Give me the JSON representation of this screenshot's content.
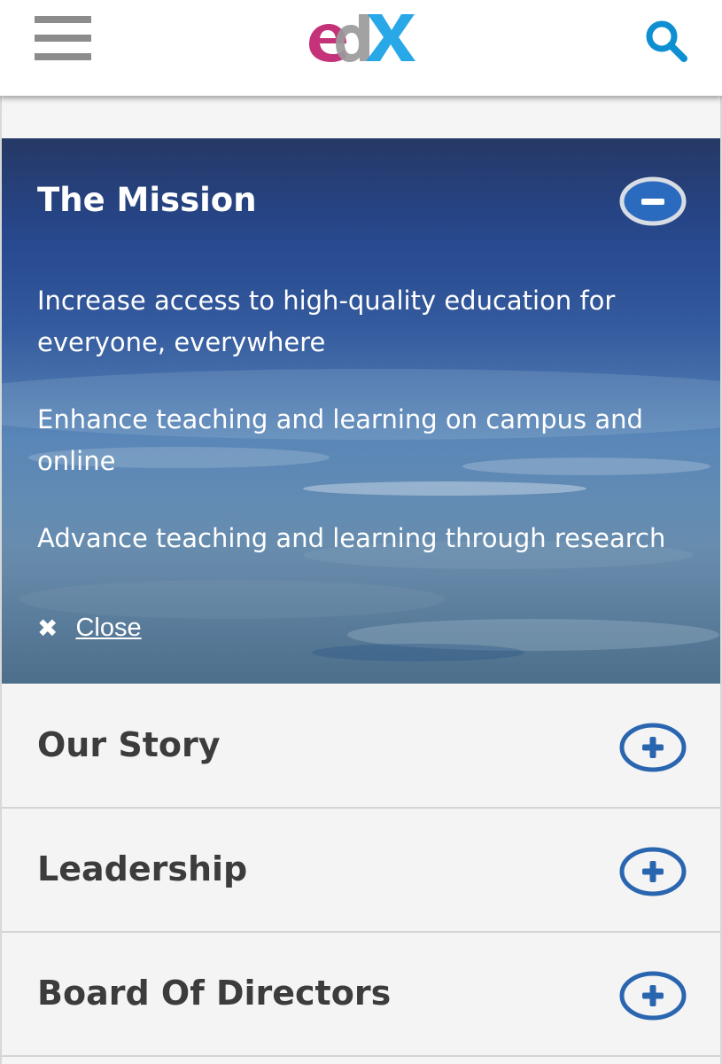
{
  "header": {
    "logo_text": "edX",
    "menu_icon": "hamburger-menu-icon",
    "search_icon": "search-icon"
  },
  "mission": {
    "title": "The Mission",
    "toggle_icon": "minus-circle-icon",
    "lines": [
      "Increase access to high-quality education for everyone, everywhere",
      "Enhance teaching and learning on campus and online",
      "Advance teaching and learning through research"
    ],
    "close_icon": "close-x-icon",
    "close_label": "Close"
  },
  "accordion": {
    "items": [
      {
        "label": "Our Story",
        "icon": "plus-circle-icon"
      },
      {
        "label": "Leadership",
        "icon": "plus-circle-icon"
      },
      {
        "label": "Board Of Directors",
        "icon": "plus-circle-icon"
      }
    ]
  },
  "colors": {
    "header_bg": "#ffffff",
    "accent_blue": "#2a66b0",
    "search_blue": "#0d8fd1",
    "logo_magenta": "#c4327a",
    "logo_gray": "#9a9a9a",
    "logo_blue": "#1ea3e6",
    "row_bg": "#f4f4f4",
    "row_text": "#3c3c3c"
  }
}
